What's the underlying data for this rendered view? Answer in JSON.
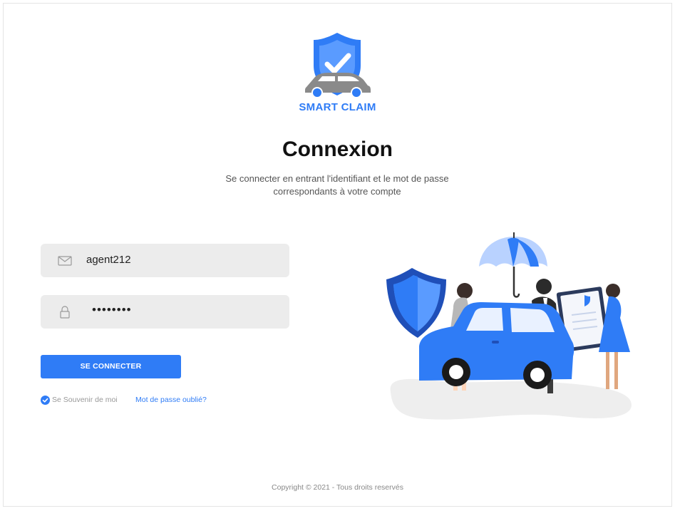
{
  "brand": {
    "name": "SMART CLAIM"
  },
  "login": {
    "title": "Connexion",
    "subtitle": "Se connecter en entrant l'identifiant et le mot de passe correspondants à votre compte",
    "email_value": "agent212",
    "password_value": "••••••••",
    "submit_label": "SE CONNECTER",
    "remember_label": "Se Souvenir de moi",
    "remember_checked": true,
    "forgot_label": "Mot de passe oublié?"
  },
  "footer": {
    "copyright": "Copyright © 2021  - Tous droits reservés"
  },
  "colors": {
    "accent": "#2f7cf6",
    "field_bg": "#ececec"
  },
  "icons": {
    "logo": "shield-check-car-icon",
    "email": "envelope-icon",
    "password": "lock-icon",
    "remember": "checkmark-circle-icon"
  }
}
